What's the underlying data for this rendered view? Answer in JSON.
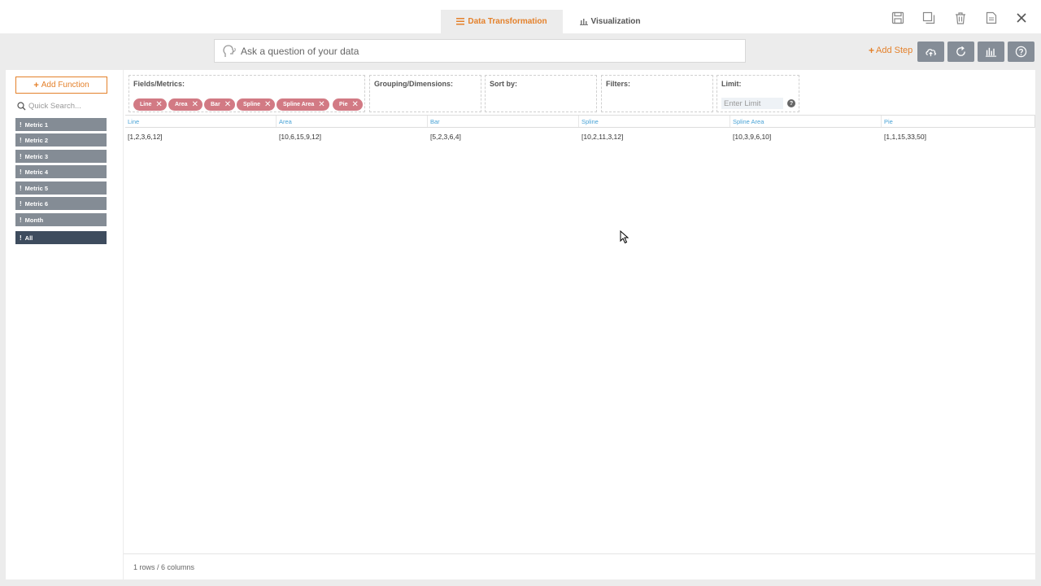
{
  "tabs": {
    "transformation": "Data Transformation",
    "visualization": "Visualization"
  },
  "header_icons": [
    "save-icon",
    "copy-icon",
    "trash-icon",
    "pdf-export-icon",
    "close-icon"
  ],
  "ask": {
    "placeholder": "Ask a question of your data"
  },
  "toolbar": {
    "add_step": "Add Step",
    "buttons": [
      "cloud-upload-icon",
      "refresh-icon",
      "bar-chart-icon",
      "help-icon"
    ]
  },
  "sidebar": {
    "add_function": "Add Function",
    "search_placeholder": "Quick Search...",
    "items": [
      {
        "label": "Metric 1"
      },
      {
        "label": "Metric 2"
      },
      {
        "label": "Metric 3"
      },
      {
        "label": "Metric 4"
      },
      {
        "label": "Metric 5"
      },
      {
        "label": "Metric 6"
      },
      {
        "label": "Month"
      }
    ],
    "all_label": "All"
  },
  "builder": {
    "fields_label": "Fields/Metrics:",
    "fields": [
      "Line",
      "Area",
      "Bar",
      "Spline",
      "Spline Area",
      "Pie"
    ],
    "grouping_label": "Grouping/Dimensions:",
    "sort_label": "Sort by:",
    "filters_label": "Filters:",
    "limit_label": "Limit:",
    "limit_placeholder": "Enter Limit"
  },
  "table": {
    "columns": [
      "Line",
      "Area",
      "Bar",
      "Spline",
      "Spline Area",
      "Pie"
    ],
    "rows": [
      [
        "[1,2,3,6,12]",
        "[10,6,15,9,12]",
        "[5,2,3,6,4]",
        "[10,2,11,3,12]",
        "[10,3,9,6,10]",
        "[1,1,15,33,50]"
      ]
    ]
  },
  "footer": {
    "summary": "1 rows / 6 columns"
  },
  "colors": {
    "accent": "#e4812b",
    "pill": "#d27a84",
    "metric": "#848c95",
    "metric_all": "#3e4c5e",
    "header_link": "#4aa3d6"
  }
}
